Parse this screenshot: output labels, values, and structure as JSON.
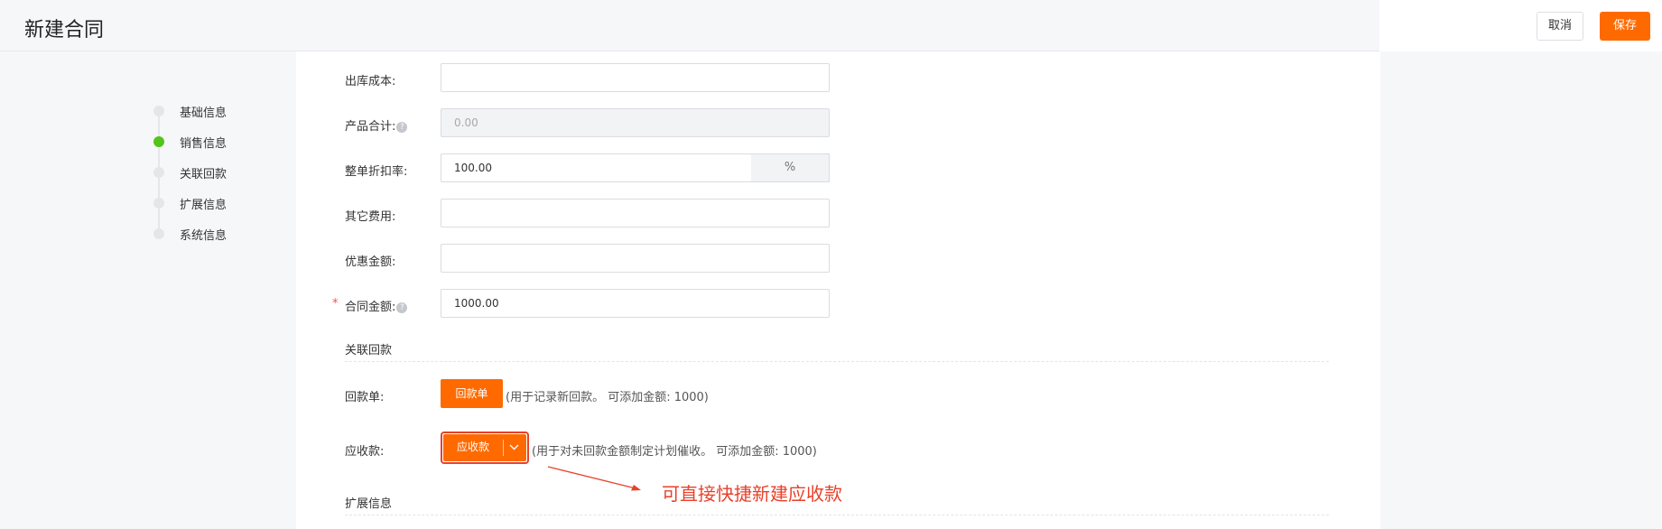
{
  "header": {
    "title": "新建合同",
    "cancel_label": "取消",
    "save_label": "保存"
  },
  "steps": [
    {
      "label": "基础信息",
      "active": false
    },
    {
      "label": "销售信息",
      "active": true
    },
    {
      "label": "关联回款",
      "active": false
    },
    {
      "label": "扩展信息",
      "active": false
    },
    {
      "label": "系统信息",
      "active": false
    }
  ],
  "form": {
    "outbound_cost": {
      "label": "出库成本:",
      "value": ""
    },
    "product_total": {
      "label": "产品合计:",
      "value": "0.00",
      "help": "?"
    },
    "discount_rate": {
      "label": "整单折扣率:",
      "value": "100.00",
      "unit": "%"
    },
    "other_fees": {
      "label": "其它费用:",
      "value": ""
    },
    "discount_amount": {
      "label": "优惠金额:",
      "value": ""
    },
    "contract_amount": {
      "label": "合同金额:",
      "value": "1000.00",
      "required": "*",
      "help": "?"
    }
  },
  "payment_section": {
    "title": "关联回款",
    "receipt": {
      "label": "回款单:",
      "button": "回款单",
      "hint": "(用于记录新回款。 可添加金额: 1000)"
    },
    "receivable": {
      "label": "应收款:",
      "button": "应收款",
      "hint": "(用于对未回款金额制定计划催收。 可添加金额: 1000)"
    }
  },
  "extension_section": {
    "title": "扩展信息"
  },
  "annotation": {
    "text": "可直接快捷新建应收款",
    "color": "#e8412a"
  },
  "colors": {
    "accent": "#ff6a00",
    "active_step": "#52c41a"
  }
}
